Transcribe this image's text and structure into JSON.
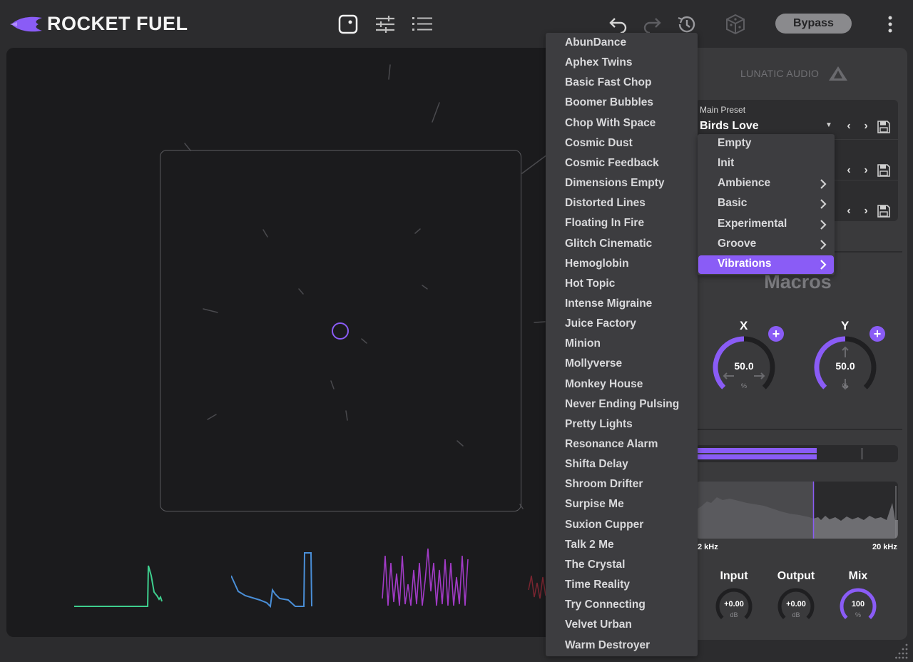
{
  "app": {
    "title": "ROCKET FUEL",
    "accent_color": "#8a5cf6"
  },
  "toolbar": {
    "left_icons": [
      "xy-pad-view-icon",
      "sliders-view-icon",
      "list-view-icon"
    ],
    "right_icons": [
      "undo-icon",
      "redo-icon",
      "history-icon",
      "randomize-cube-icon",
      "more-vertical-icon"
    ],
    "bypass_label": "Bypass"
  },
  "brand": {
    "name": "LUNATIC AUDIO"
  },
  "presets": {
    "main_caption": "Main Preset",
    "main_value": "Birds Love"
  },
  "preset_list": [
    "AbunDance",
    "Aphex Twins",
    "Basic Fast Chop",
    "Boomer Bubbles",
    "Chop With Space",
    "Cosmic Dust",
    "Cosmic Feedback",
    "Dimensions Empty",
    "Distorted Lines",
    "Floating In Fire",
    "Glitch Cinematic",
    "Hemoglobin",
    "Hot Topic",
    "Intense Migraine",
    "Juice Factory",
    "Minion",
    "Mollyverse",
    "Monkey House",
    "Never Ending Pulsing",
    "Pretty Lights",
    "Resonance Alarm",
    "Shifta Delay",
    "Shroom Drifter",
    "Surpise Me",
    "Suxion Cupper",
    "Talk 2 Me",
    "The Crystal",
    "Time Reality",
    "Try Connecting",
    "Velvet Urban",
    "Warm Destroyer"
  ],
  "category_menu": [
    {
      "label": "Empty",
      "has_submenu": false,
      "active": false
    },
    {
      "label": "Init",
      "has_submenu": false,
      "active": false
    },
    {
      "label": "Ambience",
      "has_submenu": true,
      "active": false
    },
    {
      "label": "Basic",
      "has_submenu": true,
      "active": false
    },
    {
      "label": "Experimental",
      "has_submenu": true,
      "active": false
    },
    {
      "label": "Groove",
      "has_submenu": true,
      "active": false
    },
    {
      "label": "Vibrations",
      "has_submenu": true,
      "active": true
    }
  ],
  "macros": {
    "title": "Macros",
    "x": {
      "label": "X",
      "value": "50.0",
      "unit": "%",
      "level": 0.5
    },
    "y": {
      "label": "Y",
      "value": "50.0",
      "unit": "%",
      "level": 0.5
    }
  },
  "meter": {
    "level": 0.6
  },
  "spectrum": {
    "low_label": "2 kHz",
    "high_label": "20 kHz"
  },
  "io": {
    "input": {
      "label": "Input",
      "value": "+0.00",
      "unit": "dB"
    },
    "output": {
      "label": "Output",
      "value": "+0.00",
      "unit": "dB"
    },
    "mix": {
      "label": "Mix",
      "value": "100",
      "unit": "%",
      "level": 1.0
    }
  }
}
